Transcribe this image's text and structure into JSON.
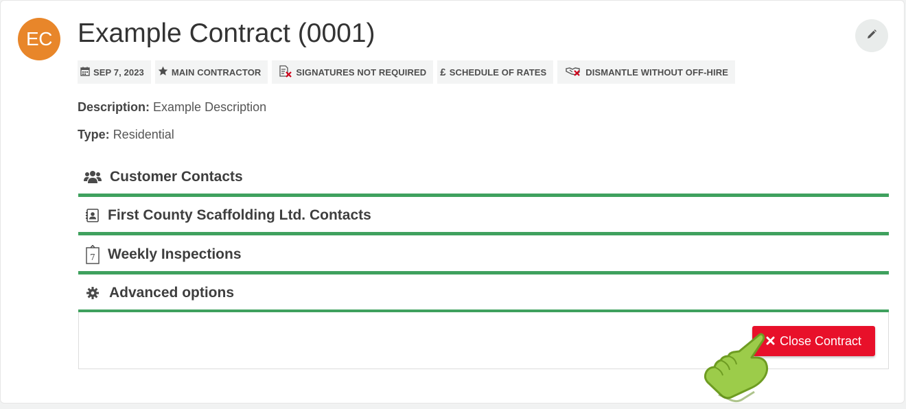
{
  "header": {
    "avatar_initials": "EC",
    "title": "Example Contract (0001)"
  },
  "badges": [
    {
      "icon": "calendar-icon",
      "label": "SEP 7, 2023"
    },
    {
      "icon": "star-icon",
      "label": "MAIN CONTRACTOR"
    },
    {
      "icon": "signature-not-required-icon",
      "label": "SIGNATURES NOT REQUIRED"
    },
    {
      "icon": "pound-icon",
      "label": "SCHEDULE OF RATES"
    },
    {
      "icon": "handshake-x-icon",
      "label": "DISMANTLE WITHOUT OFF-HIRE"
    }
  ],
  "details": {
    "description_label": "Description:",
    "description_value": "Example Description",
    "type_label": "Type:",
    "type_value": "Residential"
  },
  "sections": [
    {
      "icon": "users-icon",
      "label": "Customer Contacts"
    },
    {
      "icon": "contact-card-icon",
      "label": "First County Scaffolding Ltd. Contacts"
    },
    {
      "icon": "calendar-7-icon",
      "label": "Weekly Inspections"
    },
    {
      "icon": "gear-icon",
      "label": "Advanced options"
    }
  ],
  "actions": {
    "close_contract_label": "Close Contract",
    "close_icon": "times-icon"
  },
  "colors": {
    "avatar": "#e8862a",
    "section_border": "#3fa15e",
    "danger": "#e8102a",
    "pointer_hand": "#8cc63f"
  }
}
